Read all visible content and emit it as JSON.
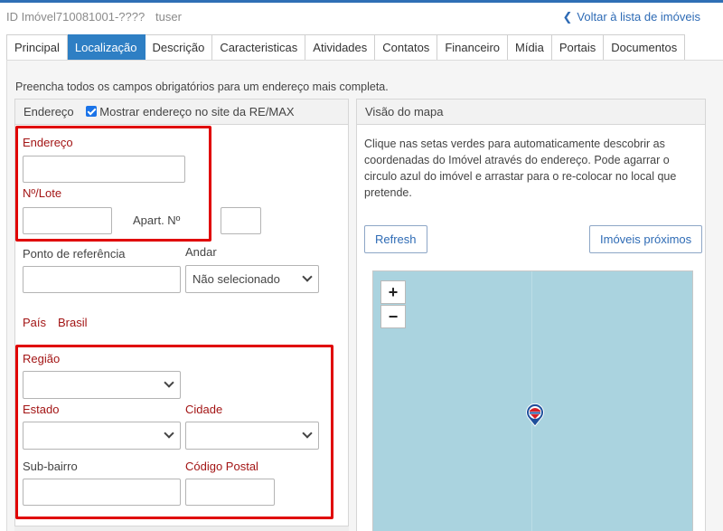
{
  "header": {
    "id_label": "ID Imóvel710081001-????",
    "user": "tuser",
    "back_link": "Voltar à lista de imóveis"
  },
  "tabs": [
    {
      "label": "Principal",
      "active": false
    },
    {
      "label": "Localização",
      "active": true
    },
    {
      "label": "Descrição",
      "active": false
    },
    {
      "label": "Caracteristicas",
      "active": false
    },
    {
      "label": "Atividades",
      "active": false
    },
    {
      "label": "Contatos",
      "active": false
    },
    {
      "label": "Financeiro",
      "active": false
    },
    {
      "label": "Mídia",
      "active": false
    },
    {
      "label": "Portais",
      "active": false
    },
    {
      "label": "Documentos",
      "active": false
    }
  ],
  "intro": "Preencha todos os campos obrigatórios para um endereço mais completa.",
  "address_panel": {
    "title": "Endereço",
    "show_address_checkbox": "Mostrar endereço no site da RE/MAX",
    "show_address_checked": true,
    "endereco_label": "Endereço",
    "endereco_value": "",
    "lote_label": "Nº/Lote",
    "lote_value": "",
    "apart_label": "Apart. Nº",
    "apart_value": "",
    "referencia_label": "Ponto de referência",
    "referencia_value": "",
    "andar_label": "Andar",
    "andar_value": "Não selecionado",
    "pais_label": "País",
    "pais_value": "Brasil",
    "regiao_label": "Região",
    "regiao_value": "",
    "estado_label": "Estado",
    "estado_value": "",
    "cidade_label": "Cidade",
    "cidade_value": "",
    "subbairro_label": "Sub-bairro",
    "subbairro_value": "",
    "cep_label": "Código Postal",
    "cep_value": ""
  },
  "map_panel": {
    "title": "Visão do mapa",
    "description": "Clique nas setas verdes para automaticamente descobrir as coordenadas do Imóvel através do endereço. Pode agarrar o circulo azul do imóvel e arrastar para o re-colocar no local que pretende.",
    "refresh_button": "Refresh",
    "nearby_button": "Imóveis próximos",
    "zoom_in": "+",
    "zoom_out": "−"
  },
  "colors": {
    "accent": "#2e7fc4",
    "required_label": "#a31515",
    "highlight_box": "#e00000",
    "map_water": "#aad3df"
  }
}
